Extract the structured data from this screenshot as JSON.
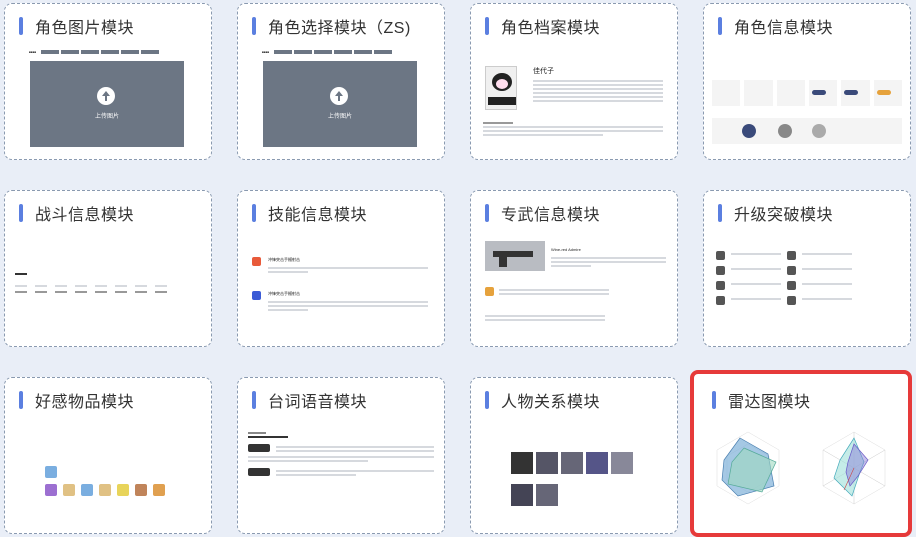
{
  "cards": [
    {
      "title": "角色图片模块",
      "upload_label": "上传图片"
    },
    {
      "title": "角色选择模块（ZS)",
      "upload_label": "上传图片"
    },
    {
      "title": "角色档案模块",
      "name": "佳代子"
    },
    {
      "title": "角色信息模块"
    },
    {
      "title": "战斗信息模块"
    },
    {
      "title": "技能信息模块",
      "skill1": "冲锋突击手榴射击",
      "skill2": "冲锋突击手榴射击"
    },
    {
      "title": "专武信息模块",
      "weapon": "Wine-red Admire"
    },
    {
      "title": "升级突破模块"
    },
    {
      "title": "好感物品模块"
    },
    {
      "title": "台词语音模块"
    },
    {
      "title": "人物关系模块"
    },
    {
      "title": "雷达图模块"
    }
  ],
  "colors": {
    "accent": "#5b7fe0",
    "selected_border": "#e63a3a",
    "background": "#e9eef7"
  }
}
